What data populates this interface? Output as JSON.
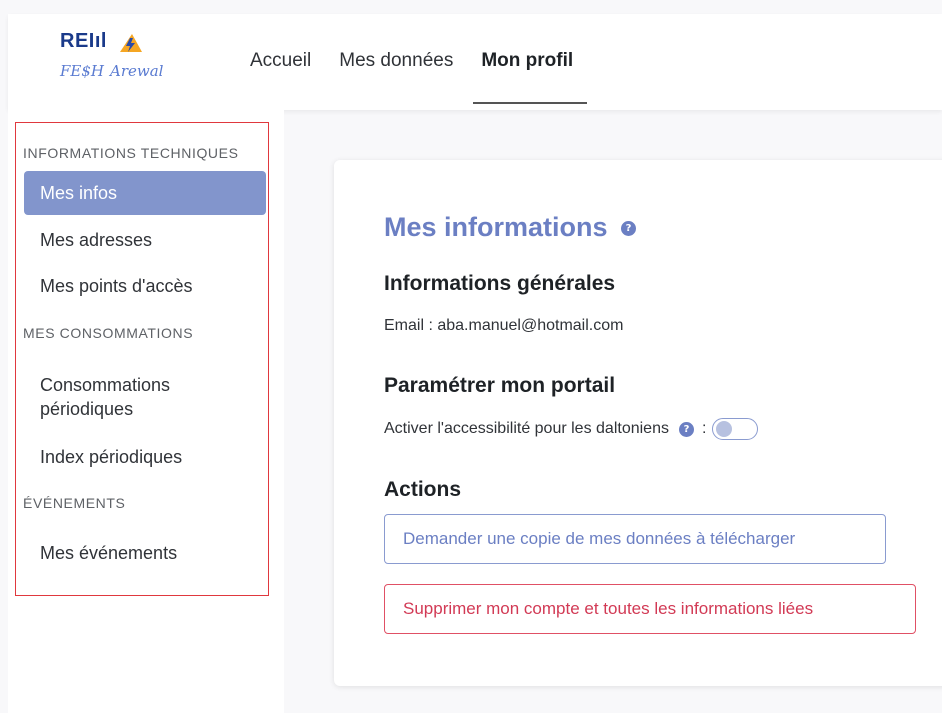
{
  "logo": {
    "line1": "REIıl",
    "line2a": "FE$H",
    "line2b": "Arewal"
  },
  "nav": {
    "items": [
      "Accueil",
      "Mes données",
      "Mon profil"
    ],
    "active": "Mon profil"
  },
  "sidebar": {
    "sections": [
      {
        "title": "INFORMATIONS TECHNIQUES",
        "items": [
          "Mes infos",
          "Mes adresses",
          "Mes points d'accès"
        ]
      },
      {
        "title": "MES CONSOMMATIONS",
        "items": [
          "Consommations périodiques",
          "Index périodiques"
        ]
      },
      {
        "title": "ÉVÉNEMENTS",
        "items": [
          "Mes événements"
        ]
      }
    ],
    "active_item": "Mes infos"
  },
  "main": {
    "title": "Mes informations",
    "general_heading": "Informations générales",
    "email_label": "Email : aba.manuel@hotmail.com",
    "portal_heading": "Paramétrer mon portail",
    "colorblind_label": "Activer l'accessibilité pour les daltoniens",
    "colorblind_separator": ":",
    "colorblind_enabled": false,
    "actions_heading": "Actions",
    "request_copy_button": "Demander une copie de mes données à télécharger",
    "delete_account_button": "Supprimer mon compte et toutes les informations liées"
  },
  "colors": {
    "accent": "#6b7fc3",
    "sidebar_active_bg": "#8295cc",
    "danger": "#d23a55",
    "highlight_border": "#e0383e"
  },
  "icons": {
    "help": "question-circle-icon"
  }
}
